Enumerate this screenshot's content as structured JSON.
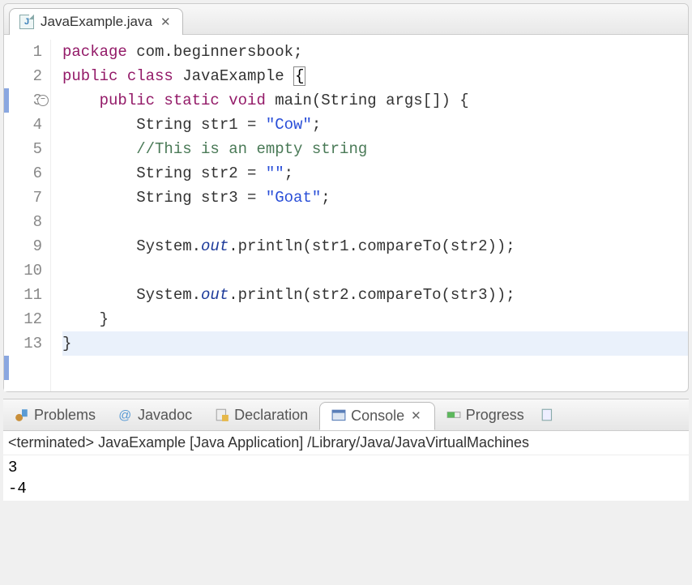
{
  "editor": {
    "tab": {
      "filename": "JavaExample.java",
      "icon_letter": "J"
    },
    "lines": [
      {
        "num": "1",
        "tokens": [
          {
            "t": "package ",
            "c": "kw"
          },
          {
            "t": "com.beginnersbook;",
            "c": "pkg"
          }
        ]
      },
      {
        "num": "2",
        "tokens": [
          {
            "t": "public class ",
            "c": "kw"
          },
          {
            "t": "JavaExample ",
            "c": "type"
          },
          {
            "t": "{",
            "c": "bracket-hl"
          }
        ],
        "hl_gutter": true
      },
      {
        "num": "3",
        "tokens": [
          {
            "t": "    ",
            "c": ""
          },
          {
            "t": "public static void ",
            "c": "kw"
          },
          {
            "t": "main(String args[]) {",
            "c": "type"
          }
        ],
        "fold": true
      },
      {
        "num": "4",
        "tokens": [
          {
            "t": "        String str1 = ",
            "c": "type"
          },
          {
            "t": "\"Cow\"",
            "c": "str"
          },
          {
            "t": ";",
            "c": "type"
          }
        ]
      },
      {
        "num": "5",
        "tokens": [
          {
            "t": "        ",
            "c": ""
          },
          {
            "t": "//This is an empty string",
            "c": "comment"
          }
        ]
      },
      {
        "num": "6",
        "tokens": [
          {
            "t": "        String str2 = ",
            "c": "type"
          },
          {
            "t": "\"\"",
            "c": "str"
          },
          {
            "t": ";",
            "c": "type"
          }
        ]
      },
      {
        "num": "7",
        "tokens": [
          {
            "t": "        String str3 = ",
            "c": "type"
          },
          {
            "t": "\"Goat\"",
            "c": "str"
          },
          {
            "t": ";",
            "c": "type"
          }
        ]
      },
      {
        "num": "8",
        "tokens": [
          {
            "t": "",
            "c": ""
          }
        ]
      },
      {
        "num": "9",
        "tokens": [
          {
            "t": "        System.",
            "c": "type"
          },
          {
            "t": "out",
            "c": "static-field"
          },
          {
            "t": ".println(str1.compareTo(str2));",
            "c": "type"
          }
        ]
      },
      {
        "num": "10",
        "tokens": [
          {
            "t": "",
            "c": ""
          }
        ]
      },
      {
        "num": "11",
        "tokens": [
          {
            "t": "        System.",
            "c": "type"
          },
          {
            "t": "out",
            "c": "static-field"
          },
          {
            "t": ".println(str2.compareTo(str3));",
            "c": "type"
          }
        ]
      },
      {
        "num": "12",
        "tokens": [
          {
            "t": "    }",
            "c": "type"
          }
        ]
      },
      {
        "num": "13",
        "tokens": [
          {
            "t": "}",
            "c": "type"
          }
        ],
        "current": true,
        "hl_gutter": true
      }
    ]
  },
  "bottom": {
    "tabs": [
      {
        "label": "Problems",
        "icon": "problems"
      },
      {
        "label": "Javadoc",
        "icon": "javadoc"
      },
      {
        "label": "Declaration",
        "icon": "declaration"
      },
      {
        "label": "Console",
        "icon": "console",
        "active": true
      },
      {
        "label": "Progress",
        "icon": "progress"
      }
    ],
    "close_icon": "✕",
    "console": {
      "header": "<terminated> JavaExample [Java Application] /Library/Java/JavaVirtualMachines",
      "output": [
        "3",
        "-4"
      ]
    }
  }
}
